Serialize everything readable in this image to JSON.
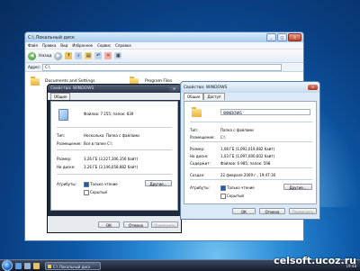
{
  "colors": {
    "accent": "#2a8ad6",
    "dark_dialog": "#1e2a3b",
    "close_button": "#c4432a"
  },
  "explorer": {
    "title": "C:\\ Локальный диск",
    "menu": [
      "Файл",
      "Правка",
      "Вид",
      "Избранное",
      "Сервис",
      "Справка"
    ],
    "toolbar": {
      "back_label": "Назад",
      "icons": [
        "up-folder-icon",
        "search-icon",
        "folders-icon",
        "undo-icon",
        "delete-icon",
        "views-icon"
      ]
    },
    "address_label": "Адрес:",
    "address_value": "C:\\",
    "items": [
      {
        "label": "Documents and Settings"
      },
      {
        "label": "Program Files"
      }
    ]
  },
  "dialog1": {
    "title": "Свойства: WINDOWS",
    "tab": "Общие",
    "files_line": "Файлов: 7 255; папок: 839",
    "type_label": "Тип:",
    "type_value": "Несколько: Папка с файлами",
    "location_label": "Размещение:",
    "location_value": "Все в папке C:\\",
    "size_label": "Размер:",
    "size_value": "3,26 ГБ (3,227,306,356 байт)",
    "disk_label": "На диске:",
    "disk_value": "3,26 ГБ (3,146,058,882 байт)",
    "attrs_label": "Атрибуты:",
    "readonly_label": "Только чтение",
    "hidden_label": "Скрытый",
    "other_btn": "Другие...",
    "ok": "ОК",
    "cancel": "Отмена",
    "apply": "Применить"
  },
  "dialog2": {
    "title": "Свойства: WINDOWS",
    "tabs": [
      "Общие",
      "Доступ"
    ],
    "name_value": "WINDOWS",
    "type_label": "Тип:",
    "type_value": "Папка с файлами",
    "location_label": "Размещение:",
    "location_value": "C:\\",
    "size_label": "Размер:",
    "size_value": "1,08 ГБ (1,092,019,682 байт)",
    "disk_label": "На диске:",
    "disk_value": "1,03 ГБ (1,097,000,602 байт)",
    "contains_label": "Содержит:",
    "contains_value": "Файлов: 6 985; папок: 598",
    "created_label": "Создан:",
    "created_value": "22 февраля 2009 г., 19:47:30",
    "attrs_label": "Атрибуты:",
    "readonly_label": "Только чтение",
    "hidden_label": "Скрытый",
    "other_btn": "Другие...",
    "ok": "ОК",
    "cancel": "Отмена",
    "apply": "Применить"
  },
  "taskbar": {
    "task_label": "C:\\ Локальный диск",
    "clock": "19:48"
  },
  "watermark": "celsoft.ucoz.ru"
}
